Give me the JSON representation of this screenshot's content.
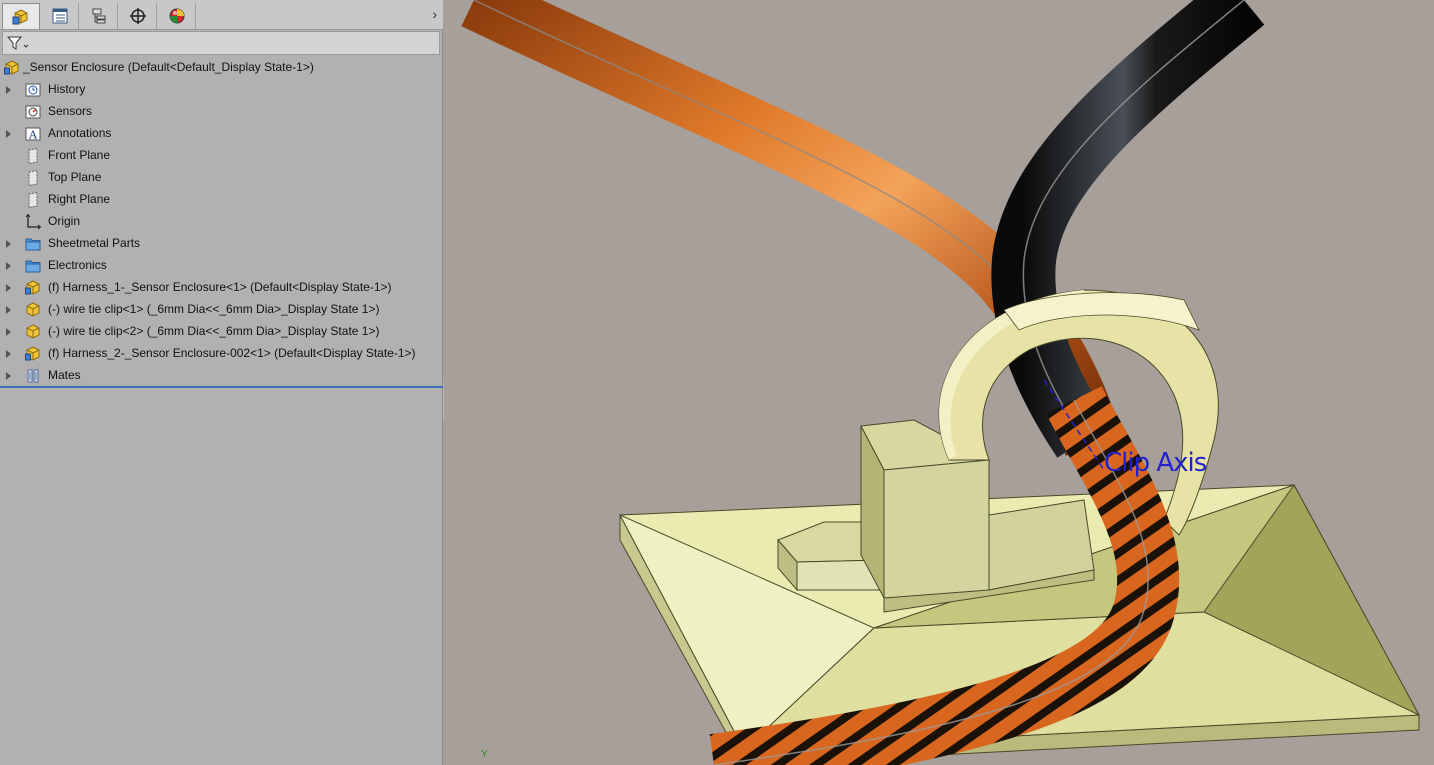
{
  "tabs": [
    {
      "name": "feature-manager",
      "icon": "assembly-icon",
      "active": true
    },
    {
      "name": "property-manager",
      "icon": "property-manager-icon"
    },
    {
      "name": "configuration-manager",
      "icon": "configuration-icon"
    },
    {
      "name": "dimxpert-manager",
      "icon": "crosshair-icon"
    },
    {
      "name": "display-manager",
      "icon": "appearance-sphere-icon"
    }
  ],
  "tree": {
    "root": "_Sensor Enclosure  (Default<Default_Display State-1>)",
    "items": [
      {
        "label": "History",
        "icon": "history-icon"
      },
      {
        "label": "Sensors",
        "icon": "sensors-icon"
      },
      {
        "label": "Annotations",
        "icon": "annotations-icon"
      },
      {
        "label": "Front Plane",
        "icon": "plane-icon"
      },
      {
        "label": "Top Plane",
        "icon": "plane-icon"
      },
      {
        "label": "Right Plane",
        "icon": "plane-icon"
      },
      {
        "label": "Origin",
        "icon": "origin-icon"
      },
      {
        "label": "Sheetmetal Parts",
        "icon": "folder-icon"
      },
      {
        "label": "Electronics",
        "icon": "folder-icon"
      },
      {
        "label": "(f) Harness_1-_Sensor Enclosure<1> (Default<Display State-1>)",
        "icon": "subassembly-icon"
      },
      {
        "label": "(-) wire tie clip<1> (_6mm Dia<<_6mm Dia>_Display State 1>)",
        "icon": "part-icon"
      },
      {
        "label": "(-) wire tie clip<2> (_6mm Dia<<_6mm Dia>_Display State 1>)",
        "icon": "part-icon"
      },
      {
        "label": "(f) Harness_2-_Sensor Enclosure-002<1> (Default<Display State-1>)",
        "icon": "subassembly-icon"
      },
      {
        "label": "Mates",
        "icon": "mates-icon"
      }
    ]
  },
  "viewport": {
    "annotation": "Clip Axis",
    "triad_axis": "Y"
  },
  "colors": {
    "viewport_bg": "#a79f99",
    "panel_bg": "#b1b1b1",
    "copper_cable": "#c8621a",
    "black_cable": "#141414",
    "clip_body": "#e4e0a4",
    "annotation": "#2222cc"
  }
}
